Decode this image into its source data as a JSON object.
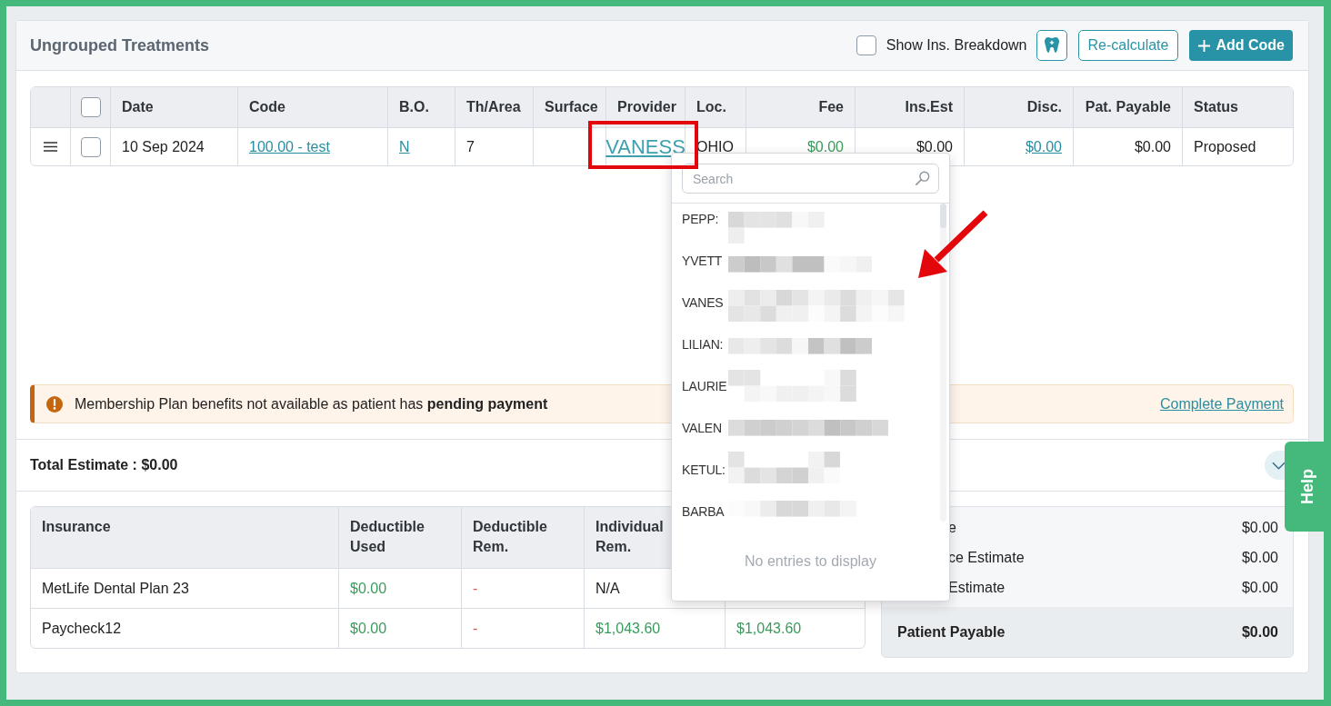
{
  "panel": {
    "title": "Ungrouped Treatments",
    "breakdown_toggle": {
      "label": "Show Ins. Breakdown",
      "checked": false
    },
    "buttons": [
      {
        "kind": "icon"
      },
      {
        "kind": "outline",
        "label": "Re-calculate"
      },
      {
        "kind": "primary",
        "label": "Add Code"
      }
    ]
  },
  "treatments": {
    "select_all": {
      "checked": false
    },
    "columns": [
      "Date",
      "Code",
      "B.O.",
      "Th/Area",
      "Surface",
      "Provider",
      "Loc.",
      "Fee",
      "Ins.Est",
      "Disc.",
      "Pat. Payable",
      "Status"
    ],
    "rows": [
      {
        "selected": false,
        "cells": [
          {
            "kind": "text",
            "text": "10 Sep 2024"
          },
          {
            "kind": "link",
            "text": "100.00 - test"
          },
          {
            "kind": "link",
            "text": "N"
          },
          {
            "kind": "text",
            "text": "7"
          },
          null,
          {
            "kind": "link_large",
            "text": "VANESS"
          },
          {
            "kind": "text",
            "text": "OHIO"
          },
          {
            "kind": "text",
            "text": "$0.00",
            "color": "#3a9b5c"
          },
          {
            "kind": "text",
            "text": "$0.00"
          },
          {
            "kind": "link",
            "text": "$0.00"
          },
          {
            "kind": "text",
            "text": "$0.00"
          },
          {
            "kind": "text",
            "text": "Proposed"
          }
        ]
      }
    ]
  },
  "provider_dropdown": {
    "search": {
      "placeholder": "Search"
    },
    "options": [
      "PEPP:",
      "YVETT",
      "VANES",
      "LILIAN:",
      "LAURIE",
      "VALEN",
      "KETUL:",
      "BARBA"
    ],
    "empty_message": "No entries to display"
  },
  "alert": {
    "message": "Membership Plan benefits not available as patient has **pending payment**",
    "action": "Complete Payment"
  },
  "total": {
    "label": "Total Estimate : $0.00"
  },
  "insurance_table": {
    "columns": [
      "Insurance",
      "Deductible Used",
      "Deductible Rem.",
      "Individual\nRem."
    ],
    "rows": [
      {
        "cells": [
          {
            "text": "MetLife Dental Plan 23"
          },
          {
            "text": "$0.00",
            "color": "#3a9b5c"
          },
          {
            "text": "-",
            "color": "#d9534f"
          },
          {
            "text": "N/A"
          }
        ]
      },
      {
        "cells": [
          {
            "text": "Paycheck12"
          },
          {
            "text": "$0.00",
            "color": "#3a9b5c"
          },
          {
            "text": "-",
            "color": "#d9534f"
          },
          {
            "text": "$1,043.60",
            "color": "#3a9b5c"
          },
          {
            "text": "$1,043.60",
            "color": "#3a9b5c"
          }
        ]
      }
    ]
  },
  "summary": {
    "rows": [
      {
        "label": "e",
        "value": "$0.00"
      },
      {
        "label": "ce Estimate",
        "value": "$0.00"
      },
      {
        "label": "Estimate",
        "value": "$0.00"
      }
    ],
    "total": {
      "label": "Patient Payable",
      "value": "$0.00"
    }
  },
  "help_tab": {
    "label": "Help"
  }
}
